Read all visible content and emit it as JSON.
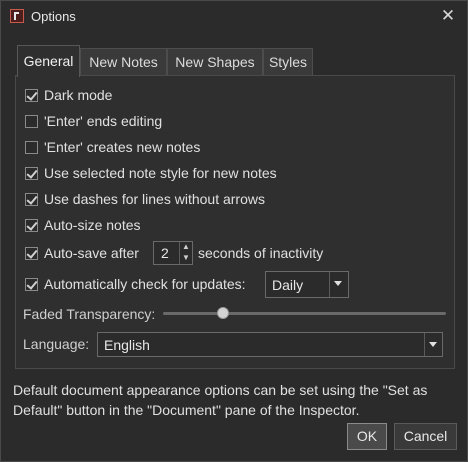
{
  "window": {
    "title": "Options",
    "icon": "app-icon",
    "close_glyph": "✕"
  },
  "tabs": [
    {
      "label": "General",
      "active": true
    },
    {
      "label": "New Notes",
      "active": false
    },
    {
      "label": "New Shapes",
      "active": false
    },
    {
      "label": "Styles",
      "active": false
    }
  ],
  "general": {
    "dark_mode": {
      "label": "Dark mode",
      "checked": true
    },
    "enter_ends_editing": {
      "label": "'Enter' ends editing",
      "checked": false
    },
    "enter_creates_notes": {
      "label": "'Enter' creates new notes",
      "checked": false
    },
    "use_selected_style": {
      "label": "Use selected note style for new notes",
      "checked": true
    },
    "use_dashes": {
      "label": "Use dashes for lines without arrows",
      "checked": true
    },
    "auto_size": {
      "label": "Auto-size notes",
      "checked": true
    },
    "auto_save": {
      "label_before": "Auto-save after",
      "value": "2",
      "label_after": "seconds of inactivity",
      "checked": true
    },
    "check_updates": {
      "label": "Automatically check for updates:",
      "checked": true,
      "frequency": "Daily"
    },
    "faded_transparency": {
      "label": "Faded Transparency:",
      "level_fraction": 0.2
    },
    "language": {
      "label": "Language:",
      "value": "English"
    }
  },
  "footer": {
    "info_text": "Default document appearance options can be set using the \"Set as Default\" button in the \"Document\" pane of the Inspector.",
    "ok_label": "OK",
    "cancel_label": "Cancel"
  }
}
